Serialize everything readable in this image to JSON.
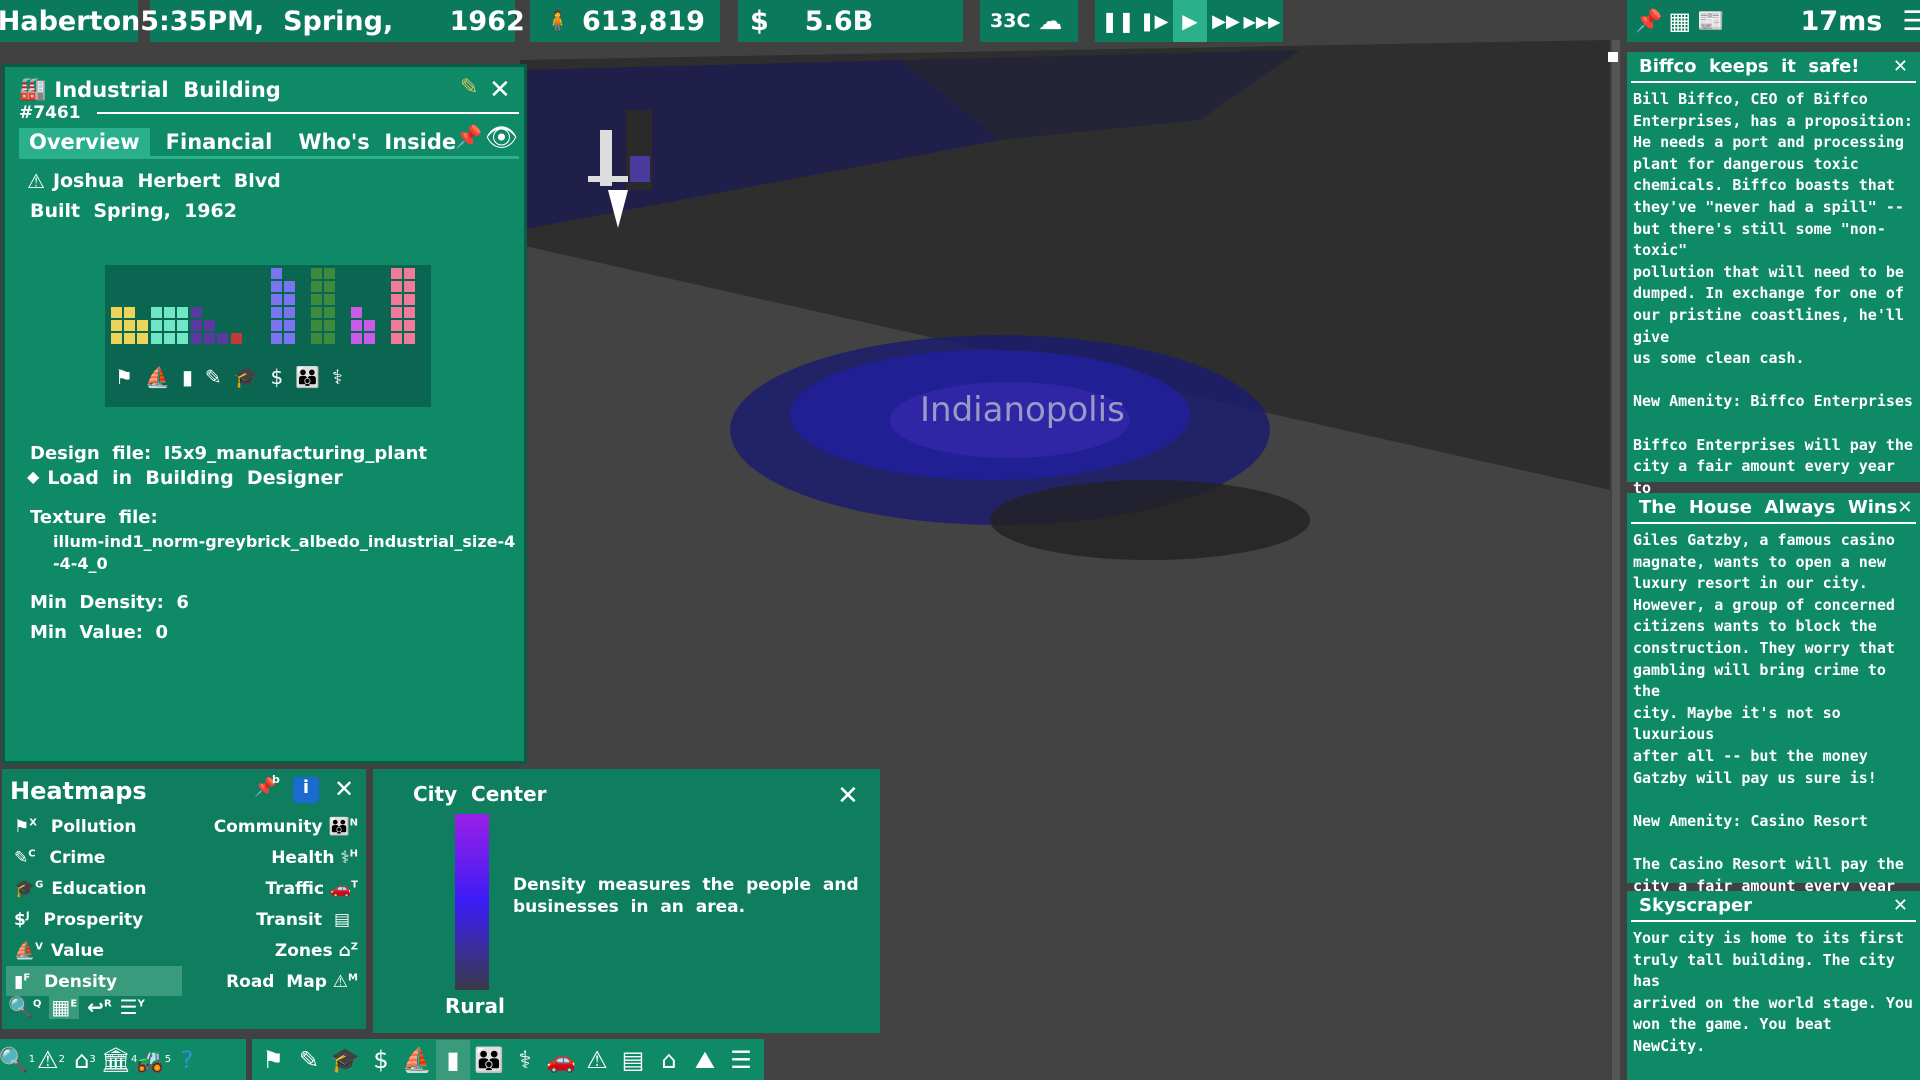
{
  "topbar": {
    "city": "Haberton",
    "datetime": "5:35PM,  Spring,      1962",
    "population": "613,819",
    "money_symbol": "$",
    "money": "5.6B",
    "temp": "33C",
    "ping": "17ms"
  },
  "building": {
    "title": "Industrial  Building",
    "id": "#7461",
    "tabs": [
      "Overview",
      "Financial",
      "Who's  Inside"
    ],
    "road": "Joshua  Herbert  Blvd",
    "built": "Built  Spring,  1962",
    "design_file": "Design  file:  I5x9_manufacturing_plant",
    "load_link": "Load  in  Building  Designer",
    "texture_label": "Texture  file:",
    "texture_value": "illum-ind1_norm-greybrick_albedo_industrial_size-4-4-4_0",
    "texture_line1": "illum-ind1_norm-greybrick_albedo_industrial_size-4",
    "texture_line2": "-4-4_0",
    "min_density": "Min  Density:  6",
    "min_value": "Min  Value:  0"
  },
  "map": {
    "city_label": "Indianopolis"
  },
  "heatmaps": {
    "title": "Heatmaps",
    "left": [
      {
        "label": "Pollution",
        "key": "X"
      },
      {
        "label": "Crime",
        "key": "C"
      },
      {
        "label": "Education",
        "key": "G"
      },
      {
        "label": "Prosperity",
        "key": "J"
      },
      {
        "label": "Value",
        "key": "V"
      },
      {
        "label": "Density",
        "key": "F"
      }
    ],
    "right": [
      {
        "label": "Community",
        "key": "N"
      },
      {
        "label": "Health",
        "key": "H"
      },
      {
        "label": "Traffic",
        "key": "T"
      },
      {
        "label": "Transit",
        "key": ""
      },
      {
        "label": "Zones",
        "key": "Z"
      },
      {
        "label": "Road  Map",
        "key": "M"
      }
    ],
    "pin_key": "b",
    "bottom_keys": [
      "Q",
      "E",
      "R",
      "Y"
    ]
  },
  "legend": {
    "title": "City  Center",
    "bottom": "Rural",
    "description": "Density  measures  the  people  and  businesses  in  an  area."
  },
  "news": [
    {
      "title": "Biffco  keeps  it  safe!",
      "body": "Bill Biffco, CEO of Biffco\nEnterprises, has a proposition:\nHe needs a port and processing\nplant for dangerous toxic\nchemicals. Biffco boasts that\nthey've \"never had a spill\" --\nbut there's still some \"non-toxic\"\npollution that will need to be\ndumped. In exchange for one of\nour pristine coastlines, he'll give\nus some clean cash.\n\nNew Amenity: Biffco Enterprises\n\nBiffco Enterprises will pay the\ncity a fair amount every year to\ncompensate for the inevitable\npollution from the plant."
    },
    {
      "title": "The  House  Always  Wins",
      "body": "Giles Gatzby, a famous casino\nmagnate, wants to open a new\nluxury resort in our city.\nHowever, a group of concerned\ncitizens wants to block the\nconstruction. They worry that\ngambling will bring crime to the\ncity. Maybe it's not so luxurious\nafter all -- but the money\nGatzby will pay us sure is!\n\nNew Amenity: Casino Resort\n\nThe Casino Resort will pay the\ncity a fair amount every year to\ncompensate for extra policing."
    },
    {
      "title": "Skyscraper",
      "body": "Your city is home to its first\ntruly tall building. The city has\narrived on the world stage. You\nwon the game. You beat\nNewCity.\n\nNew Amenity: Grand Park"
    }
  ],
  "bottombar": {
    "keys": [
      "1",
      "2",
      "3",
      "4",
      "5"
    ]
  },
  "colors": {
    "panel": "#0f8a66",
    "panel_dark": "#0a5a44",
    "accent": "#2ab08a",
    "density_top": "#9b1fe8",
    "density_mid": "#3b1cf5"
  }
}
